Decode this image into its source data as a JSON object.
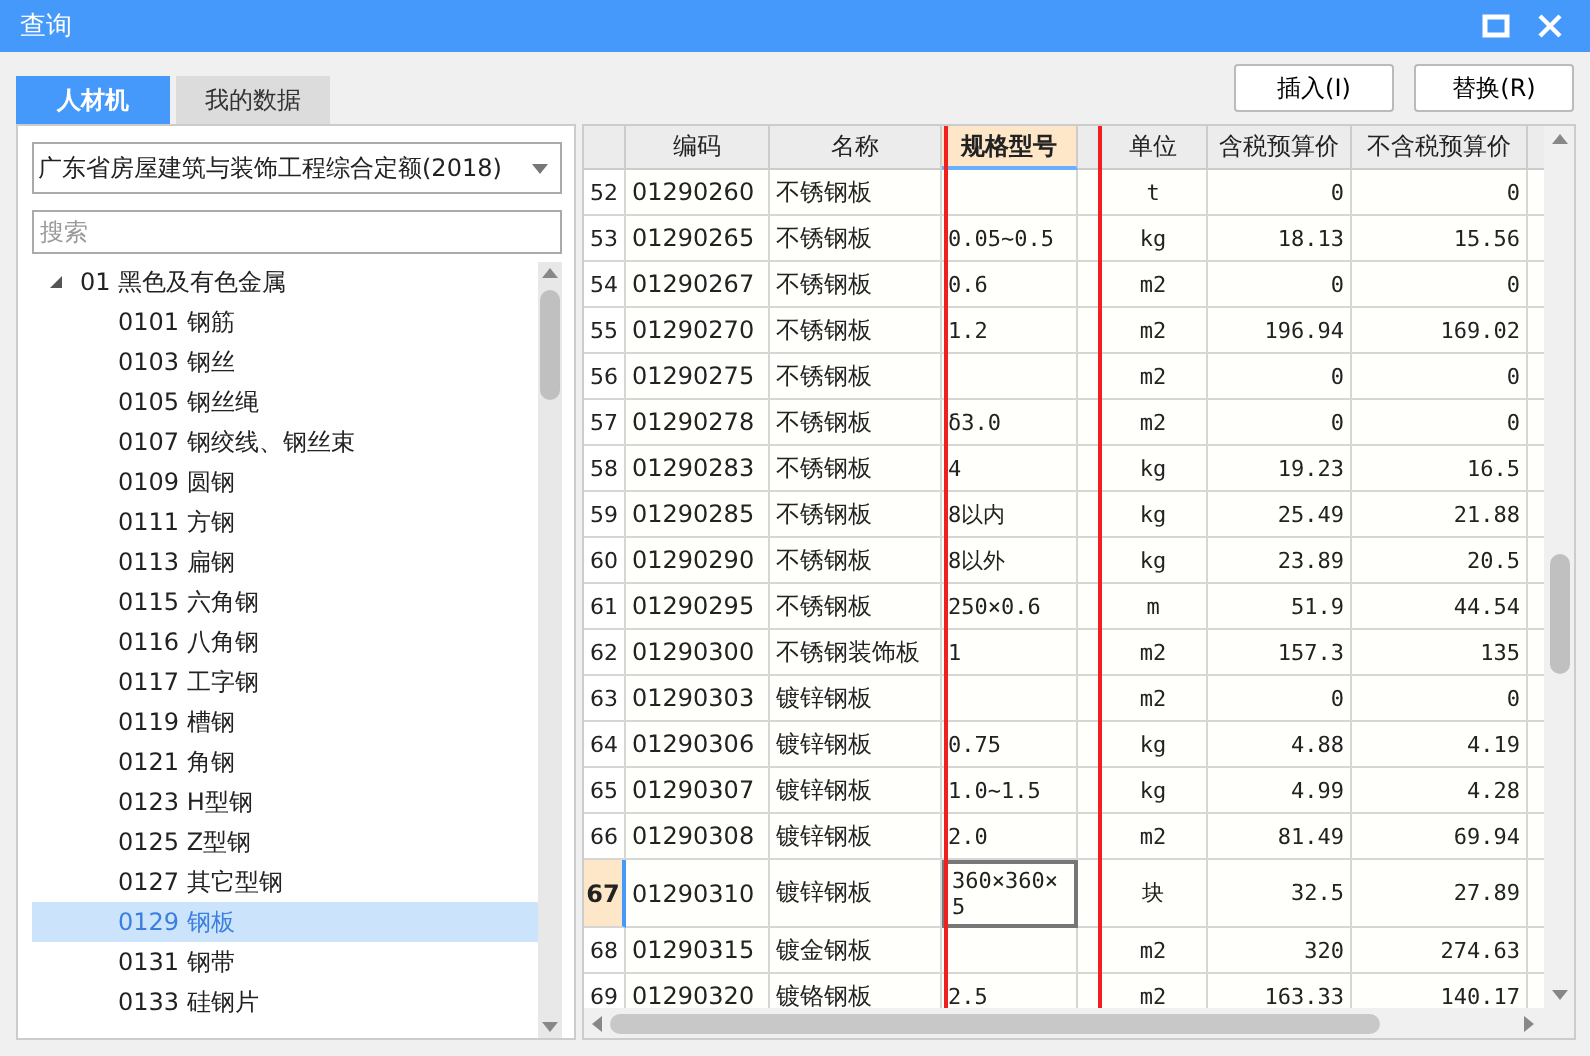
{
  "window": {
    "title": "查询"
  },
  "tabs": [
    {
      "label": "人材机",
      "selected": true
    },
    {
      "label": "我的数据",
      "selected": false
    }
  ],
  "buttons": [
    "插入(I)",
    "替换(R)"
  ],
  "library_select": {
    "value": "广东省房屋建筑与装饰工程综合定额(2018)"
  },
  "search": {
    "placeholder": "搜索"
  },
  "tree": [
    {
      "label": "01 黑色及有色金属",
      "expanded": true,
      "selected": false,
      "children": [
        {
          "label": "0101 钢筋",
          "selected": false
        },
        {
          "label": "0103 钢丝",
          "selected": false
        },
        {
          "label": "0105 钢丝绳",
          "selected": false
        },
        {
          "label": "0107 钢绞线、钢丝束",
          "selected": false
        },
        {
          "label": "0109 圆钢",
          "selected": false
        },
        {
          "label": "0111 方钢",
          "selected": false
        },
        {
          "label": "0113 扁钢",
          "selected": false
        },
        {
          "label": "0115 六角钢",
          "selected": false
        },
        {
          "label": "0116 八角钢",
          "selected": false
        },
        {
          "label": "0117 工字钢",
          "selected": false
        },
        {
          "label": "0119 槽钢",
          "selected": false
        },
        {
          "label": "0121 角钢",
          "selected": false
        },
        {
          "label": "0123 H型钢",
          "selected": false
        },
        {
          "label": "0125 Z型钢",
          "selected": false
        },
        {
          "label": "0127 其它型钢",
          "selected": false
        },
        {
          "label": "0129 钢板",
          "selected": true
        },
        {
          "label": "0131 钢带",
          "selected": false
        },
        {
          "label": "0133 硅钢片",
          "selected": false
        }
      ]
    }
  ],
  "table": {
    "columns": [
      {
        "label": "编码",
        "selected": false
      },
      {
        "label": "名称",
        "selected": false
      },
      {
        "label": "规格型号",
        "selected": true
      },
      {
        "label": "单位",
        "selected": false
      },
      {
        "label": "含税预算价",
        "selected": false
      },
      {
        "label": "不含税预算价",
        "selected": false
      }
    ],
    "rows": [
      {
        "num": "52",
        "code": "01290260",
        "name": "不锈钢板",
        "spec": "",
        "unit": "t",
        "price_tax": "0",
        "price_notax": "0",
        "selected": false
      },
      {
        "num": "53",
        "code": "01290265",
        "name": "不锈钢板",
        "spec": "0.05~0.5",
        "unit": "kg",
        "price_tax": "18.13",
        "price_notax": "15.56",
        "selected": false
      },
      {
        "num": "54",
        "code": "01290267",
        "name": "不锈钢板",
        "spec": "0.6",
        "unit": "m2",
        "price_tax": "0",
        "price_notax": "0",
        "selected": false
      },
      {
        "num": "55",
        "code": "01290270",
        "name": "不锈钢板",
        "spec": "1.2",
        "unit": "m2",
        "price_tax": "196.94",
        "price_notax": "169.02",
        "selected": false
      },
      {
        "num": "56",
        "code": "01290275",
        "name": "不锈钢板",
        "spec": "",
        "unit": "m2",
        "price_tax": "0",
        "price_notax": "0",
        "selected": false
      },
      {
        "num": "57",
        "code": "01290278",
        "name": "不锈钢板",
        "spec": "δ3.0",
        "unit": "m2",
        "price_tax": "0",
        "price_notax": "0",
        "selected": false
      },
      {
        "num": "58",
        "code": "01290283",
        "name": "不锈钢板",
        "spec": "4",
        "unit": "kg",
        "price_tax": "19.23",
        "price_notax": "16.5",
        "selected": false
      },
      {
        "num": "59",
        "code": "01290285",
        "name": "不锈钢板",
        "spec": "8以内",
        "unit": "kg",
        "price_tax": "25.49",
        "price_notax": "21.88",
        "selected": false
      },
      {
        "num": "60",
        "code": "01290290",
        "name": "不锈钢板",
        "spec": "8以外",
        "unit": "kg",
        "price_tax": "23.89",
        "price_notax": "20.5",
        "selected": false
      },
      {
        "num": "61",
        "code": "01290295",
        "name": "不锈钢板",
        "spec": "250×0.6",
        "unit": "m",
        "price_tax": "51.9",
        "price_notax": "44.54",
        "selected": false
      },
      {
        "num": "62",
        "code": "01290300",
        "name": "不锈钢装饰板",
        "spec": "1",
        "unit": "m2",
        "price_tax": "157.3",
        "price_notax": "135",
        "selected": false
      },
      {
        "num": "63",
        "code": "01290303",
        "name": "镀锌钢板",
        "spec": "",
        "unit": "m2",
        "price_tax": "0",
        "price_notax": "0",
        "selected": false
      },
      {
        "num": "64",
        "code": "01290306",
        "name": "镀锌钢板",
        "spec": "0.75",
        "unit": "kg",
        "price_tax": "4.88",
        "price_notax": "4.19",
        "selected": false
      },
      {
        "num": "65",
        "code": "01290307",
        "name": "镀锌钢板",
        "spec": "1.0~1.5",
        "unit": "kg",
        "price_tax": "4.99",
        "price_notax": "4.28",
        "selected": false
      },
      {
        "num": "66",
        "code": "01290308",
        "name": "镀锌钢板",
        "spec": "2.0",
        "unit": "m2",
        "price_tax": "81.49",
        "price_notax": "69.94",
        "selected": false
      },
      {
        "num": "67",
        "code": "01290310",
        "name": "镀锌钢板",
        "spec": "360×360×5",
        "unit": "块",
        "price_tax": "32.5",
        "price_notax": "27.89",
        "selected": true
      },
      {
        "num": "68",
        "code": "01290315",
        "name": "镀金钢板",
        "spec": "",
        "unit": "m2",
        "price_tax": "320",
        "price_notax": "274.63",
        "selected": false
      },
      {
        "num": "69",
        "code": "01290320",
        "name": "镀铬钢板",
        "spec": "2.5",
        "unit": "m2",
        "price_tax": "163.33",
        "price_notax": "140.17",
        "selected": false
      }
    ]
  }
}
